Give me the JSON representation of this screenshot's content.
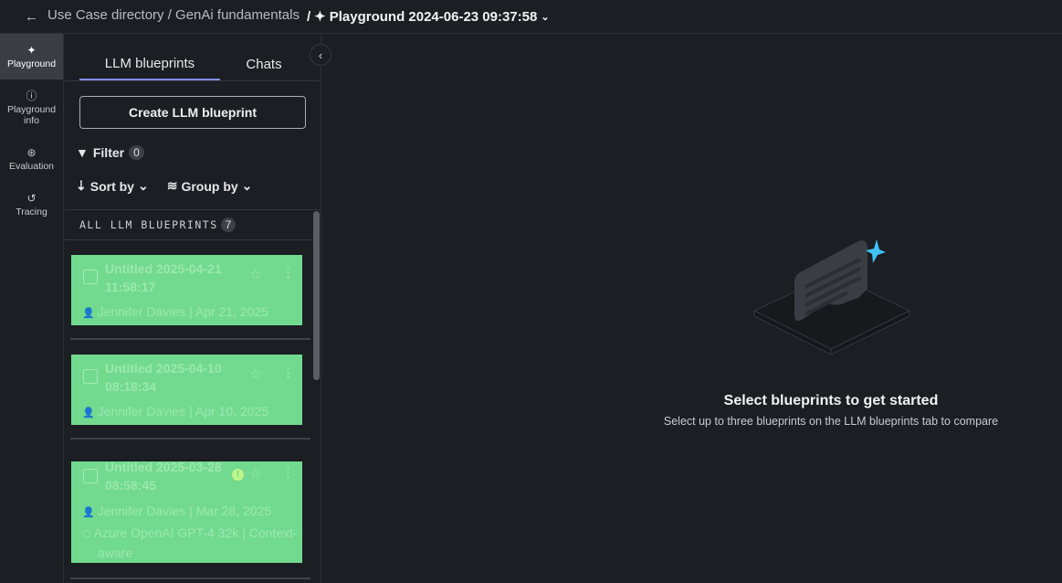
{
  "header": {
    "breadcrumb": "Use Case directory / GenAi fundamentals",
    "separator": "/",
    "current": "Playground 2024-06-23 09:37:58"
  },
  "rail": [
    {
      "label": "Playground",
      "icon": "sparkle-icon"
    },
    {
      "label": "Playground info",
      "icon": "info-icon"
    },
    {
      "label": "Evaluation",
      "icon": "evaluation-icon"
    },
    {
      "label": "Tracing",
      "icon": "history-icon"
    }
  ],
  "panel": {
    "tabs": [
      "LLM blueprints",
      "Chats"
    ],
    "create_label": "Create LLM blueprint",
    "filter_label": "Filter",
    "filter_count": "0",
    "sort_label": "Sort by",
    "group_label": "Group by",
    "list_header": "ALL LLM BLUEPRINTS",
    "list_count": "7",
    "blueprints": [
      {
        "title": "Untitled 2025-04-21 11:58:17",
        "author": "Jennifer Davies",
        "date": "Apr 21, 2025"
      },
      {
        "title": "Untitled 2025-04-10 08:18:34",
        "author": "Jennifer Davies",
        "date": "Apr 10, 2025"
      },
      {
        "title": "Untitled 2025-03-28 08:58:45",
        "author": "Jennifer Davies",
        "date": "Mar 28, 2025",
        "model": "Azure OpenAI GPT-4 32k | Context-aware"
      }
    ]
  },
  "empty": {
    "title": "Select blueprints to get started",
    "subtitle": "Select up to three blueprints on the LLM blueprints tab to compare"
  },
  "colors": {
    "accent": "#7f8ef0",
    "card": "#72da8f",
    "star": "#3ec1f5"
  }
}
